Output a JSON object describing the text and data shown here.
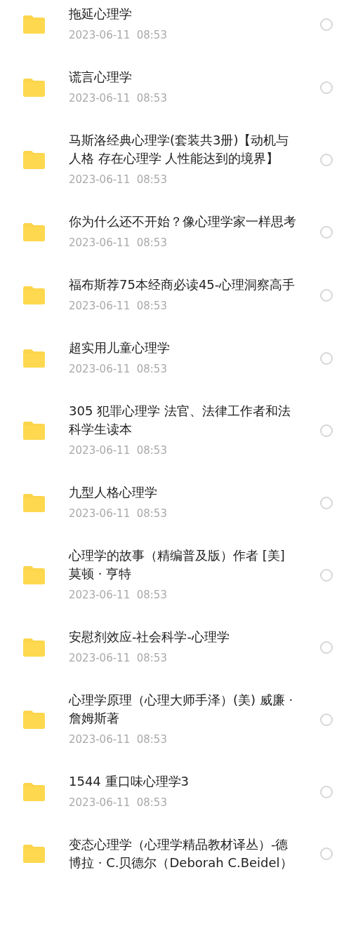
{
  "files": [
    {
      "name": "拖延心理学",
      "date": "2023-06-11  08:53",
      "selected": false
    },
    {
      "name": "谎言心理学",
      "date": "2023-06-11  08:53",
      "selected": false
    },
    {
      "name": "马斯洛经典心理学(套装共3册)【动机与人格 存在心理学 人性能达到的境界】",
      "date": "2023-06-11  08:53",
      "selected": false
    },
    {
      "name": "你为什么还不开始？像心理学家一样思考",
      "date": "2023-06-11  08:53",
      "selected": false
    },
    {
      "name": "福布斯荐75本经商必读45-心理洞察高手",
      "date": "2023-06-11  08:53",
      "selected": false
    },
    {
      "name": "超实用儿童心理学",
      "date": "2023-06-11  08:53",
      "selected": false
    },
    {
      "name": "305 犯罪心理学 法官、法律工作者和法科学生读本",
      "date": "2023-06-11  08:53",
      "selected": false
    },
    {
      "name": "九型人格心理学",
      "date": "2023-06-11  08:53",
      "selected": false
    },
    {
      "name": "心理学的故事（精编普及版）作者 [美] 莫顿 · 亨特",
      "date": "2023-06-11  08:53",
      "selected": false
    },
    {
      "name": "安慰剂效应-社会科学-心理学",
      "date": "2023-06-11  08:53",
      "selected": false
    },
    {
      "name": "心理学原理（心理大师手泽）(美) 威廉 · 詹姆斯著",
      "date": "2023-06-11  08:53",
      "selected": false
    },
    {
      "name": "1544 重口味心理学3",
      "date": "2023-06-11  08:53",
      "selected": false
    },
    {
      "name": "变态心理学（心理学精品教材译丛）-德博拉 · C.贝德尔（Deborah C.Beidel）",
      "selected": false
    }
  ]
}
